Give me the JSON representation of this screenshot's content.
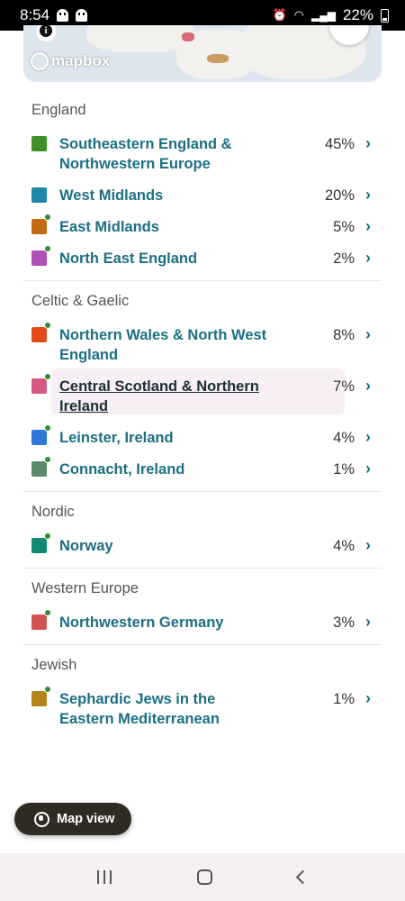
{
  "status_bar": {
    "time": "8:54",
    "battery": "22%"
  },
  "map": {
    "attribution": "mapbox"
  },
  "sections": [
    {
      "title": "England",
      "items": [
        {
          "name": "Southeastern England & Northwestern Europe",
          "pct": "45%",
          "color": "#3f8f2a",
          "new": false
        },
        {
          "name": "West Midlands",
          "pct": "20%",
          "color": "#1f88a8",
          "new": false
        },
        {
          "name": "East Midlands",
          "pct": "5%",
          "color": "#c46b12",
          "new": true
        },
        {
          "name": "North East England",
          "pct": "2%",
          "color": "#b24fb5",
          "new": true
        }
      ]
    },
    {
      "title": "Celtic & Gaelic",
      "items": [
        {
          "name": "Northern Wales & North West England",
          "pct": "8%",
          "color": "#e24a1c",
          "new": true
        },
        {
          "name": "Central Scotland & Northern Ireland",
          "pct": "7%",
          "color": "#d45a83",
          "new": true
        },
        {
          "name": "Leinster, Ireland",
          "pct": "4%",
          "color": "#2f78d8",
          "new": true
        },
        {
          "name": "Connacht, Ireland",
          "pct": "1%",
          "color": "#5a8a6a",
          "new": true
        }
      ]
    },
    {
      "title": "Nordic",
      "items": [
        {
          "name": "Norway",
          "pct": "4%",
          "color": "#128a72",
          "new": true
        }
      ]
    },
    {
      "title": "Western Europe",
      "items": [
        {
          "name": "Northwestern Germany",
          "pct": "3%",
          "color": "#d05252",
          "new": true
        }
      ]
    },
    {
      "title": "Jewish",
      "items": [
        {
          "name": "Sephardic Jews in the Eastern Mediterranean",
          "pct": "1%",
          "color": "#b5851a",
          "new": true
        }
      ]
    }
  ],
  "map_view_button": "Map view"
}
